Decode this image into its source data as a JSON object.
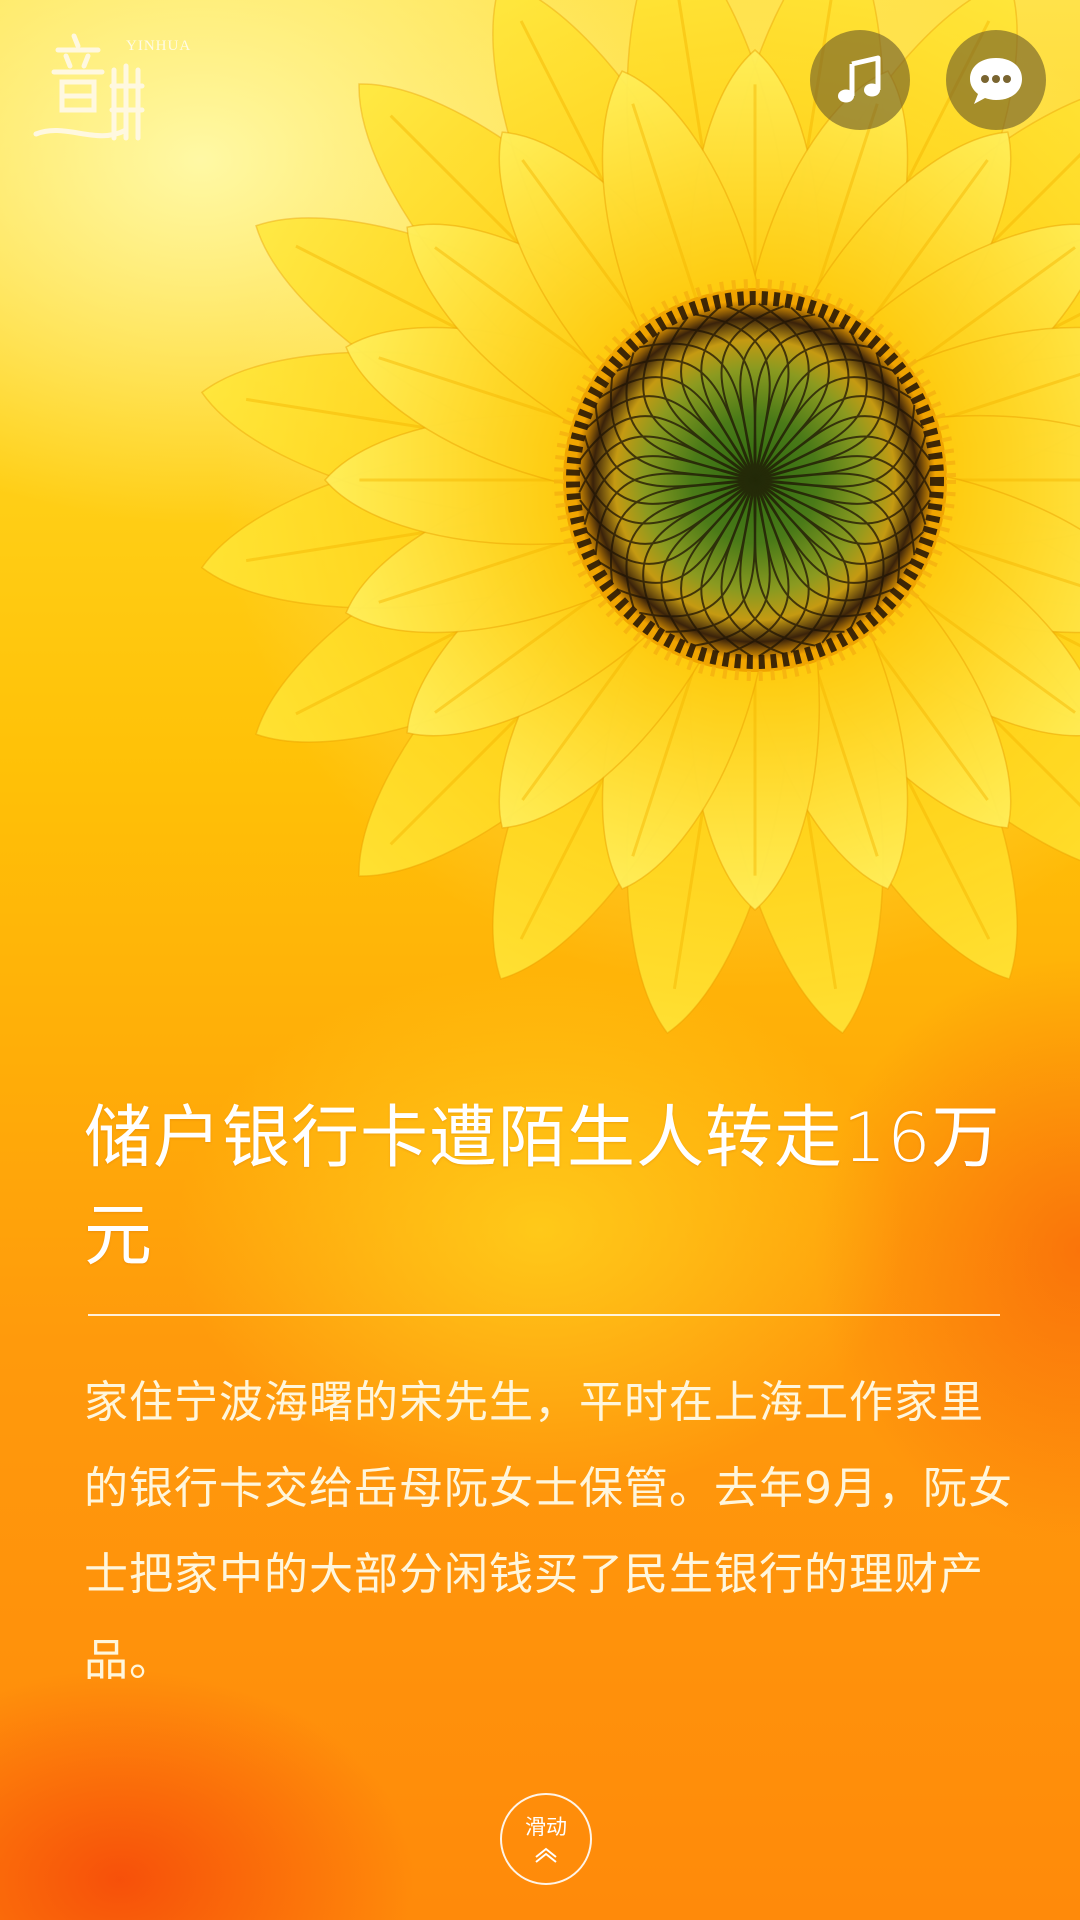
{
  "header": {
    "logo_text_en": "YINHUA",
    "music_button_icon": "music-note-icon",
    "chat_button_icon": "speech-bubble-icon"
  },
  "article": {
    "title": "储户银行卡遭陌生人转走16万元",
    "body": "家住宁波海曙的宋先生，平时在上海工作家里的银行卡交给岳母阮女士保管。去年9月，阮女士把家中的大部分闲钱买了民生银行的理财产品。"
  },
  "footer": {
    "swipe_label": "滑动",
    "swipe_icon": "chevron-up-icon"
  },
  "colors": {
    "background_top": "#ffe24a",
    "background_bottom": "#ff8a0a",
    "button_bg": "#6e5c28",
    "text": "#ffffff"
  }
}
